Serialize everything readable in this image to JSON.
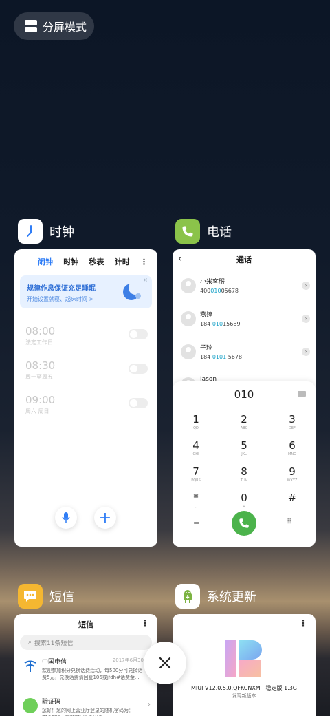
{
  "split_screen": {
    "label": "分屏模式"
  },
  "apps": {
    "clock": {
      "name": "时钟",
      "tabs": [
        "闹钟",
        "时钟",
        "秒表",
        "计时"
      ],
      "banner": {
        "title": "规律作息保证充足睡眠",
        "subtitle": "开始设置就寝、起床时间 >"
      },
      "alarms": [
        {
          "time": "08:00",
          "repeat": "法定工作日"
        },
        {
          "time": "08:30",
          "repeat": "周一至周五"
        },
        {
          "time": "09:00",
          "repeat": "周六 周日"
        }
      ]
    },
    "phone": {
      "name": "电话",
      "title": "通话",
      "contacts": [
        {
          "name": "小米客服",
          "pre": "400",
          "hl": "010",
          "post": "05678"
        },
        {
          "name": "燕婷",
          "pre": "184 ",
          "hl": "010",
          "post": "15689"
        },
        {
          "name": "子玲",
          "pre": "184 ",
          "hl": "0101",
          "post": " 5678"
        },
        {
          "name": "Jason",
          "pre": "",
          "hl": "",
          "post": ""
        }
      ],
      "dial_input": "010",
      "keys": [
        {
          "d": "1",
          "l": "QD"
        },
        {
          "d": "2",
          "l": "ABC"
        },
        {
          "d": "3",
          "l": "DEF"
        },
        {
          "d": "4",
          "l": "GHI"
        },
        {
          "d": "5",
          "l": "JKL"
        },
        {
          "d": "6",
          "l": "MNO"
        },
        {
          "d": "7",
          "l": "PQRS"
        },
        {
          "d": "8",
          "l": "TUV"
        },
        {
          "d": "9",
          "l": "WXYZ"
        },
        {
          "d": "*",
          "l": ","
        },
        {
          "d": "0",
          "l": "+"
        },
        {
          "d": "#",
          "l": ""
        }
      ]
    },
    "sms": {
      "name": "短信",
      "title": "短信",
      "search_placeholder": "搜索11条短信",
      "messages": [
        {
          "name": "中国电信",
          "date": "2017年6月30",
          "text": "欢迎参加积分兑换话费活动，每500分可兑换话费5元，兑换话费请回复106或jfdh#话费金..."
        },
        {
          "name": "验证码",
          "date": "",
          "text": "您好！您的网上营业厅登录的随机密码为：710679，有效时间为3分钟"
        }
      ]
    },
    "update": {
      "name": "系统更新",
      "version": "MIUI V12.0.5.0.QFKCNXM | 稳定版 1.3G",
      "status": "发现新版本"
    }
  },
  "colors": {
    "accent": "#2f7df6",
    "phone_green": "#8bc34a",
    "sms_yellow": "#f5b731",
    "call_green": "#4cb34c"
  }
}
